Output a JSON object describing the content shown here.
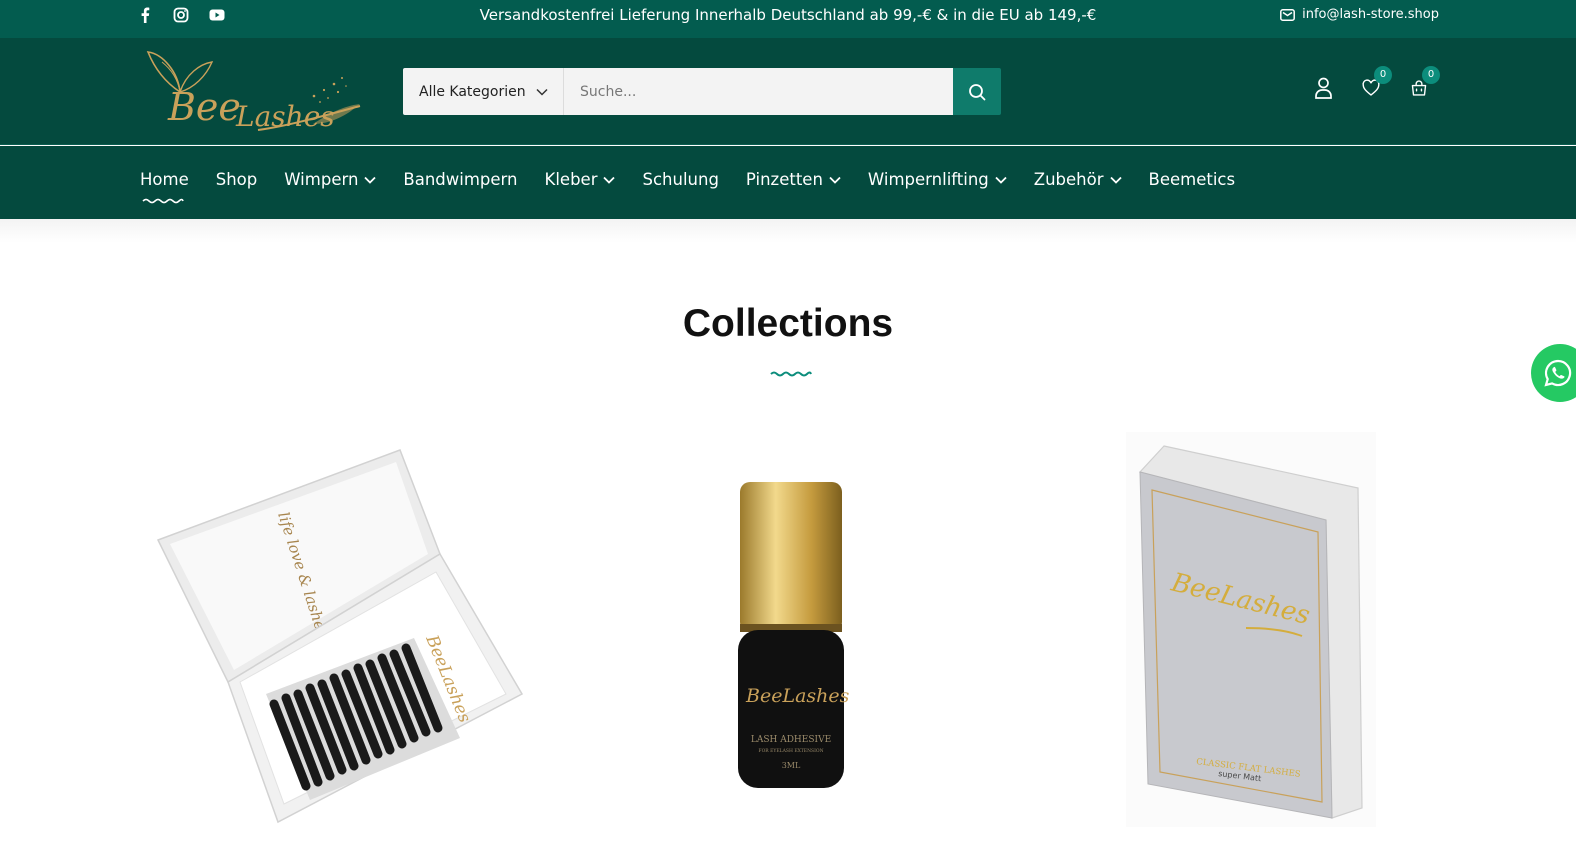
{
  "topbar": {
    "social_icons": [
      "facebook-icon",
      "instagram-icon",
      "youtube-icon"
    ],
    "promo": "Versandkostenfrei Lieferung Innerhalb Deutschland ab 99,-€ & in die EU ab 149,-€",
    "email": "info@lash-store.shop"
  },
  "header": {
    "logo_text": "BeeLashes",
    "search": {
      "category_label": "Alle Kategorien",
      "placeholder": "Suche..."
    },
    "wishlist_count": "0",
    "cart_count": "0"
  },
  "nav": {
    "items": [
      {
        "label": "Home",
        "dropdown": false,
        "active": true
      },
      {
        "label": "Shop",
        "dropdown": false
      },
      {
        "label": "Wimpern",
        "dropdown": true
      },
      {
        "label": "Bandwimpern",
        "dropdown": false
      },
      {
        "label": "Kleber",
        "dropdown": true
      },
      {
        "label": "Schulung",
        "dropdown": false
      },
      {
        "label": "Pinzetten",
        "dropdown": true
      },
      {
        "label": "Wimpernlifting",
        "dropdown": true
      },
      {
        "label": "Zubehör",
        "dropdown": true
      },
      {
        "label": "Beemetics",
        "dropdown": false
      }
    ]
  },
  "collections": {
    "title": "Collections",
    "products": [
      {
        "box_script": "life love & lashes",
        "brand": "BeeLashes"
      },
      {
        "brand": "BeeLashes",
        "line1": "LASH ADHESIVE",
        "line2": "FOR EYELASH EXTENSION",
        "size": "3ML"
      },
      {
        "brand": "BeeLashes",
        "line1": "CLASSIC FLAT LASHES",
        "line2": "super Matt"
      }
    ]
  },
  "colors": {
    "topbar": "#035c4f",
    "header": "#044a3e",
    "accent": "#0f7b6b",
    "gold": "#c9a15a",
    "whatsapp": "#25c963"
  }
}
